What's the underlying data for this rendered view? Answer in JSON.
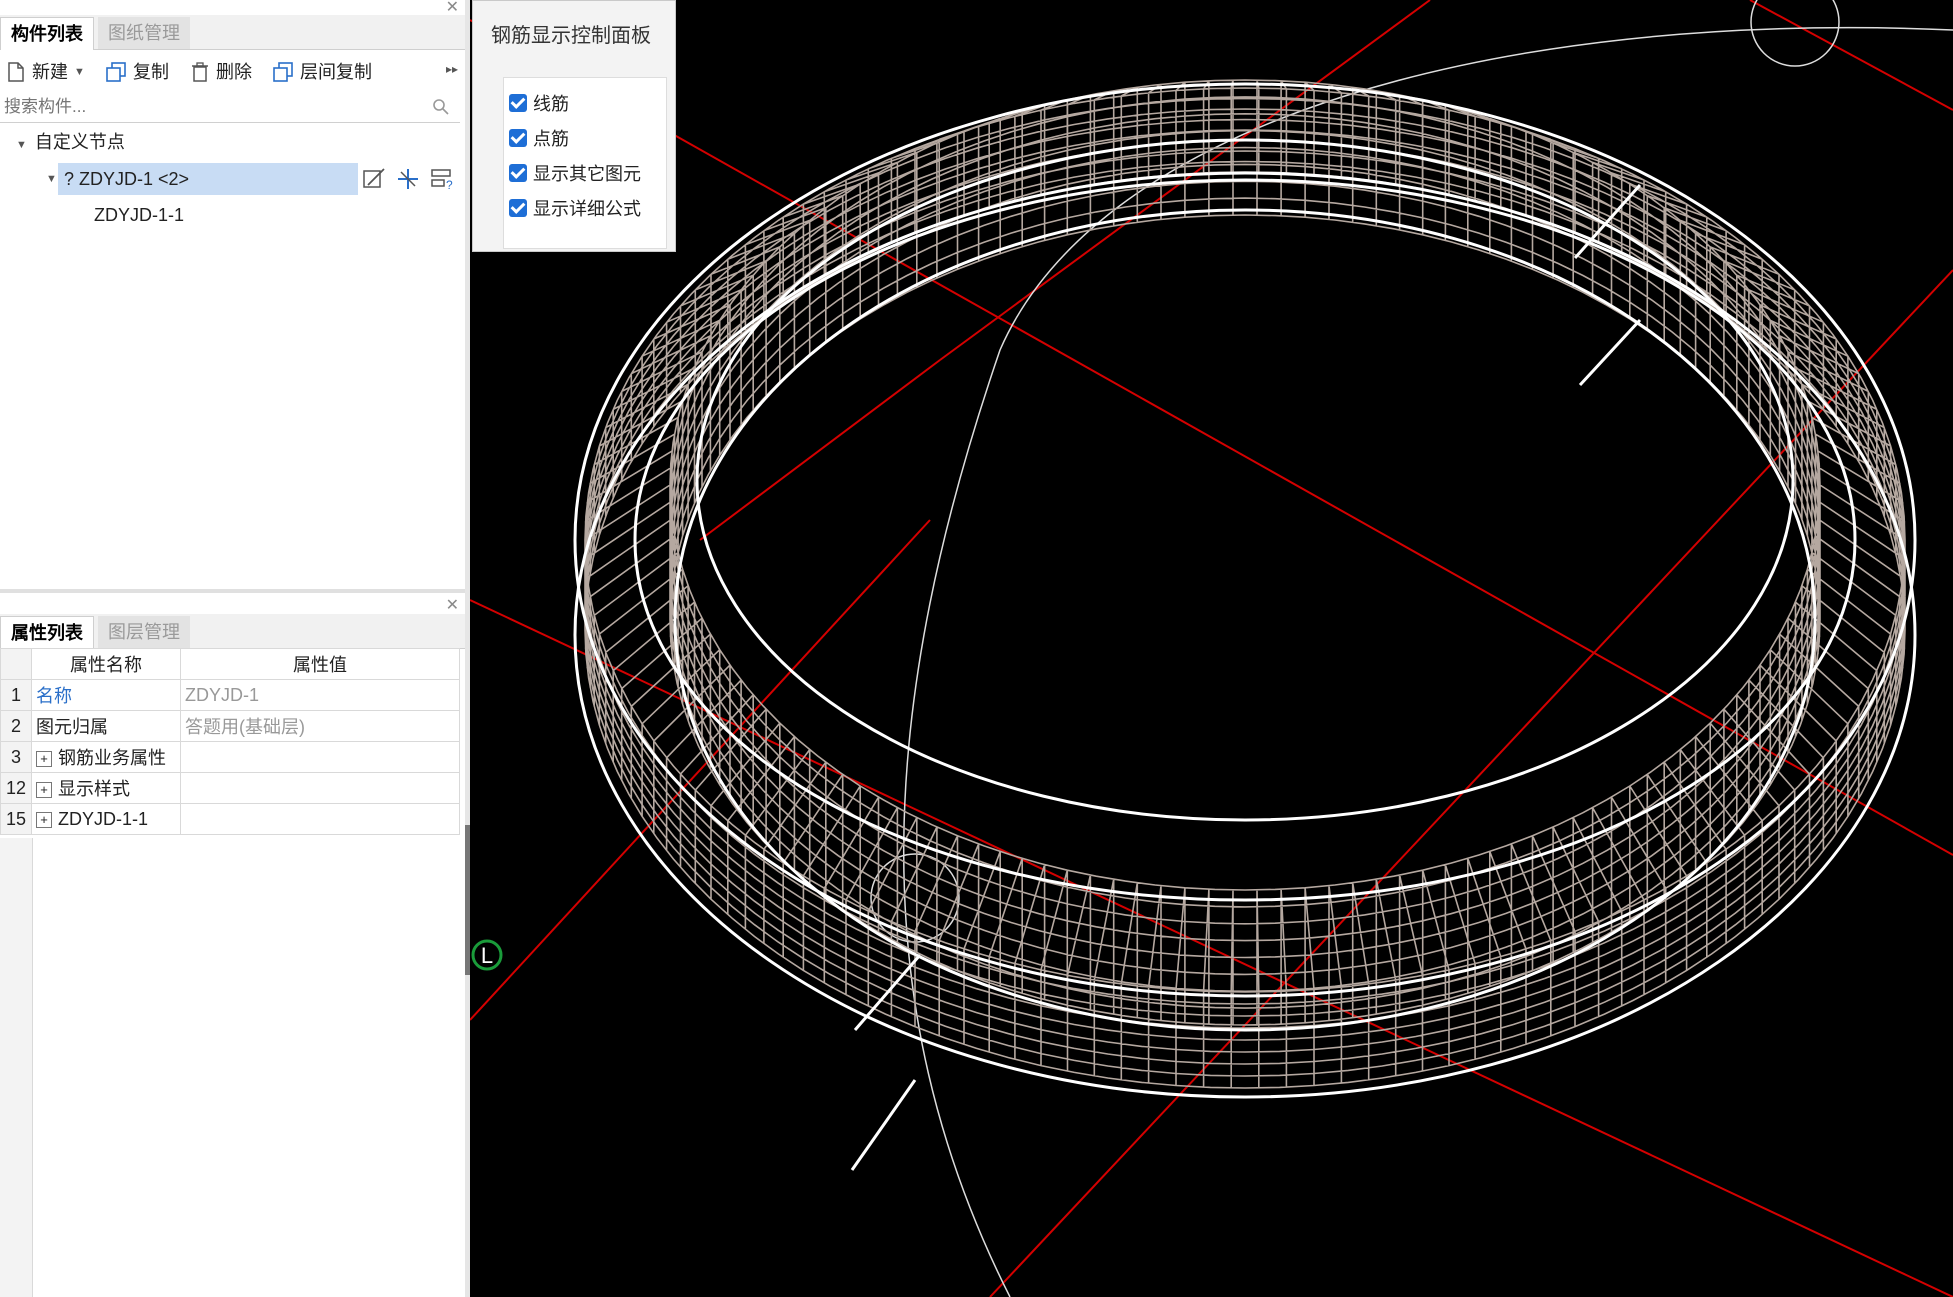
{
  "top_panel": {
    "tabs": [
      {
        "label": "构件列表"
      },
      {
        "label": "图纸管理"
      }
    ],
    "toolbar": {
      "new": "新建",
      "copy": "复制",
      "delete": "删除",
      "floor_copy": "层间复制"
    },
    "search_placeholder": "搜索构件...",
    "tree": {
      "root": "自定义节点",
      "node": "? ZDYJD-1 <2>",
      "child": "ZDYJD-1-1"
    }
  },
  "bottom_panel": {
    "tabs": [
      {
        "label": "属性列表"
      },
      {
        "label": "图层管理"
      }
    ],
    "headers": {
      "name": "属性名称",
      "value": "属性值"
    },
    "rows": [
      {
        "num": "1",
        "name": "名称",
        "value": "ZDYJD-1",
        "expandable": false
      },
      {
        "num": "2",
        "name": "图元归属",
        "value": "答题用(基础层)",
        "expandable": false
      },
      {
        "num": "3",
        "name": "钢筋业务属性",
        "value": "",
        "expandable": true
      },
      {
        "num": "12",
        "name": "显示样式",
        "value": "",
        "expandable": true
      },
      {
        "num": "15",
        "name": "ZDYJD-1-1",
        "value": "",
        "expandable": true
      }
    ]
  },
  "control_panel": {
    "title": "钢筋显示控制面板",
    "options": [
      {
        "label": "线筋",
        "checked": true
      },
      {
        "label": "点筋",
        "checked": true
      },
      {
        "label": "显示其它图元",
        "checked": true
      },
      {
        "label": "显示详细公式",
        "checked": true
      }
    ]
  },
  "viewport": {
    "axis_marker": "L",
    "colors": {
      "background": "#000000",
      "axis": "#e00000",
      "outline": "#ffffff",
      "rebar": "#b5a8a0",
      "selection": "#c8dcf4",
      "checkbox": "#1e6ed6"
    }
  }
}
